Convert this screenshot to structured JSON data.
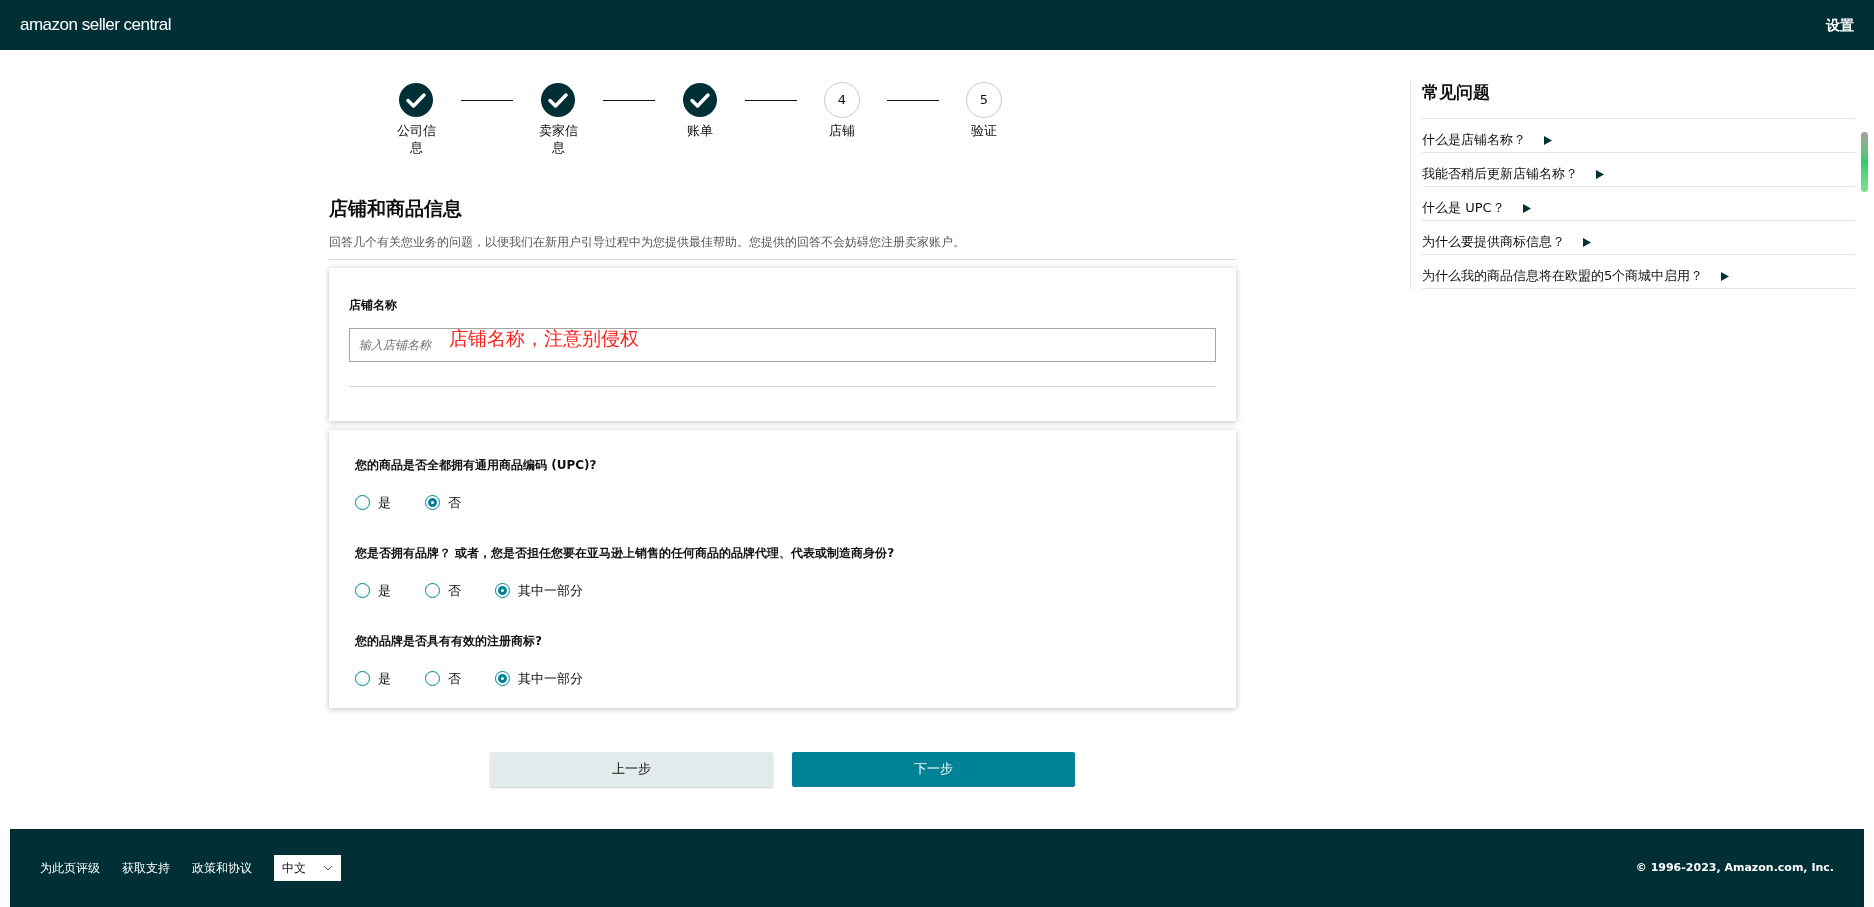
{
  "header": {
    "logo": "amazon seller central",
    "settings": "设置"
  },
  "steps": [
    {
      "label": "公司信息",
      "kind": "done"
    },
    {
      "label": "卖家信息",
      "kind": "done"
    },
    {
      "label": "账单",
      "kind": "done"
    },
    {
      "label": "店铺",
      "kind": "pending",
      "number": "4"
    },
    {
      "label": "验证",
      "kind": "pending",
      "number": "5"
    }
  ],
  "section": {
    "title": "店铺和商品信息",
    "subtitle": "回答几个有关您业务的问题，以便我们在新用户引导过程中为您提供最佳帮助。您提供的回答不会妨碍您注册卖家账户。"
  },
  "store_name": {
    "label": "店铺名称",
    "placeholder": "输入店铺名称",
    "annotation": "店铺名称，注意别侵权"
  },
  "questions": [
    {
      "text": "您的商品是否全都拥有通用商品编码 (UPC)?",
      "options": [
        {
          "label": "是",
          "selected": false
        },
        {
          "label": "否",
          "selected": true
        }
      ]
    },
    {
      "text": "您是否拥有品牌？ 或者，您是否担任您要在亚马逊上销售的任何商品的品牌代理、代表或制造商身份?",
      "options": [
        {
          "label": "是",
          "selected": false
        },
        {
          "label": "否",
          "selected": false
        },
        {
          "label": "其中一部分",
          "selected": true
        }
      ]
    },
    {
      "text": "您的品牌是否具有有效的注册商标?",
      "options": [
        {
          "label": "是",
          "selected": false
        },
        {
          "label": "否",
          "selected": false
        },
        {
          "label": "其中一部分",
          "selected": true
        }
      ]
    }
  ],
  "buttons": {
    "back": "上一步",
    "next": "下一步"
  },
  "faq": {
    "title": "常见问题",
    "items": [
      {
        "text": "什么是店铺名称？",
        "expanded": false
      },
      {
        "text": "我能否稍后更新店铺名称？",
        "expanded": false
      },
      {
        "text": "什么是 UPC？",
        "expanded": false
      },
      {
        "text": "为什么要提供商标信息？",
        "expanded": false
      },
      {
        "text": "为什么我的商品信息将在欧盟的5个商城中启用？",
        "expanded": false
      }
    ]
  },
  "footer": {
    "links": [
      "为此页评级",
      "获取支持",
      "政策和协议"
    ],
    "language": "中文",
    "copyright": "© 1996-2023, Amazon.com, Inc."
  }
}
